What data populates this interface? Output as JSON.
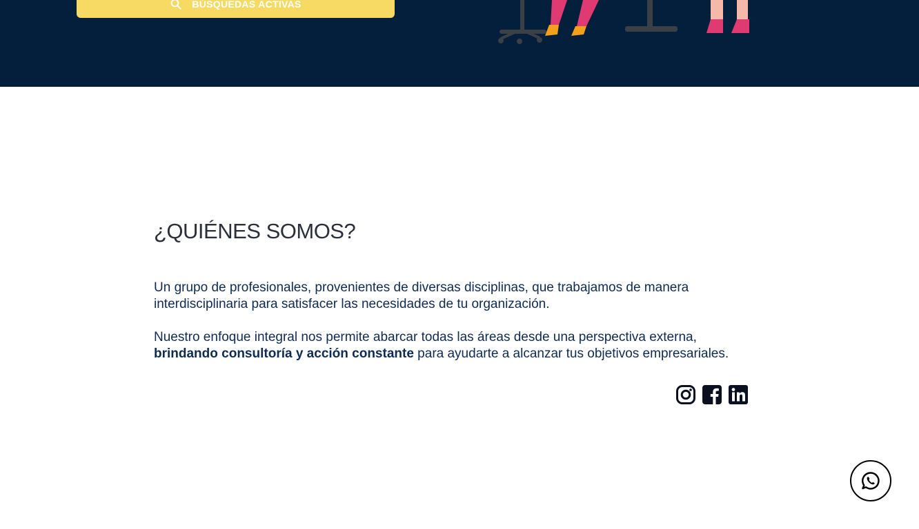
{
  "hero": {
    "cta_label": "BÚSQUEDAS ACTIVAS",
    "cta_icon": "search-icon",
    "colors": {
      "background": "#041f3b",
      "cta": "#f6da63"
    }
  },
  "about": {
    "heading": "¿QUIÉNES SOMOS?",
    "paragraph1": "Un grupo de profesionales, provenientes de diversas disciplinas, que trabajamos de manera interdisciplinaria para satisfacer las necesidades de tu organización.",
    "paragraph2_before": "Nuestro enfoque integral nos permite abarcar todas las áreas desde una perspectiva externa, ",
    "paragraph2_bold": "brindando consultoría y acción constante",
    "paragraph2_after": " para ayudarte a alcanzar tus objetivos empresariales.",
    "text_color": "#0f2b52"
  },
  "social": {
    "icons": [
      "instagram-icon",
      "facebook-icon",
      "linkedin-icon"
    ]
  },
  "floating": {
    "icon": "whatsapp-icon"
  }
}
